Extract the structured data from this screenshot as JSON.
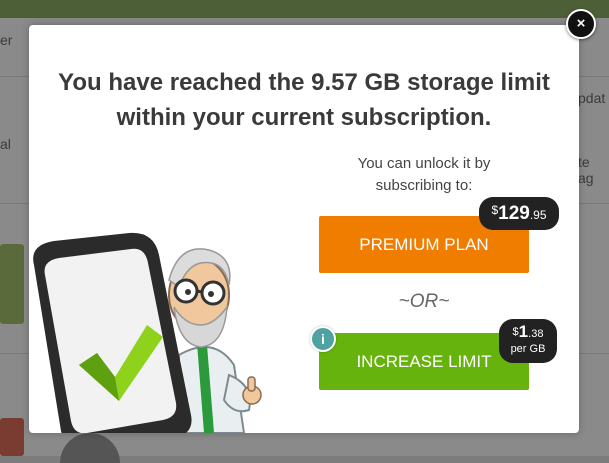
{
  "background": {
    "left_text_1": "er",
    "left_text_2": "al",
    "right_text_1": "pdat",
    "right_text_2": "te ag"
  },
  "modal": {
    "headline_line1": "You have reached the 9.57 GB storage limit",
    "headline_line2": "within your current subscription.",
    "unlock_line1": "You can unlock it by",
    "unlock_line2": "subscribing to:",
    "premium_button_label": "PREMIUM PLAN",
    "premium_price": {
      "currency": "$",
      "whole": "129",
      "decimal": ".95"
    },
    "or_text": "~OR~",
    "increase_button_label": "INCREASE LIMIT",
    "increase_price": {
      "currency": "$",
      "whole": "1",
      "decimal": ".38",
      "unit": "per GB"
    },
    "info_icon_glyph": "i",
    "close_icon_glyph": "×"
  },
  "colors": {
    "premium_button": "#f07c00",
    "increase_button": "#67b30d",
    "price_badge": "#222222",
    "info_icon": "#4ea3a0"
  },
  "icons": [
    "close-icon",
    "info-icon",
    "phone-checkmark-illustration",
    "scientist-illustration"
  ]
}
